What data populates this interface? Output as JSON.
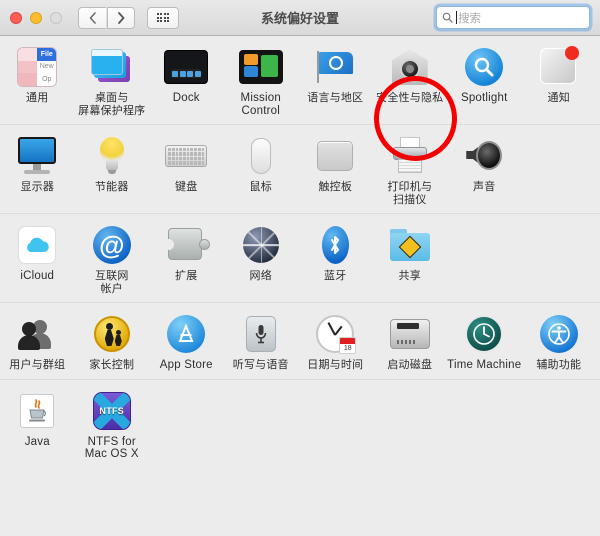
{
  "window": {
    "title": "系统偏好设置",
    "traffic_lights": [
      {
        "name": "close",
        "color": "#ff5f57",
        "enabled": true
      },
      {
        "name": "minimize",
        "color": "#ffbd2e",
        "enabled": true
      },
      {
        "name": "zoom",
        "color": "#dedede",
        "enabled": false
      }
    ]
  },
  "toolbar": {
    "back_label": "‹",
    "forward_label": "›",
    "show_all_label": "显示全部",
    "search": {
      "placeholder": "搜索",
      "value": "",
      "icon": "search-icon",
      "focused": true
    }
  },
  "annotation": {
    "type": "red-ellipse-highlight",
    "color": "#f40000",
    "targets": "安全性与隐私"
  },
  "rows": [
    {
      "index": 0,
      "items": [
        {
          "label": "通用",
          "icon": "general-icon"
        },
        {
          "label": "桌面与\n屏幕保护程序",
          "icon": "desktop-screensaver-icon"
        },
        {
          "label": "Dock",
          "icon": "dock-icon",
          "en": true
        },
        {
          "label": "Mission\nControl",
          "icon": "mission-control-icon",
          "en": true
        },
        {
          "label": "语言与地区",
          "icon": "language-region-icon"
        },
        {
          "label": "安全性与隐私",
          "icon": "security-privacy-icon",
          "highlighted": true
        },
        {
          "label": "Spotlight",
          "icon": "spotlight-icon",
          "en": true
        },
        {
          "label": "通知",
          "icon": "notifications-icon",
          "badge": true
        }
      ]
    },
    {
      "index": 1,
      "items": [
        {
          "label": "显示器",
          "icon": "displays-icon"
        },
        {
          "label": "节能器",
          "icon": "energy-saver-icon"
        },
        {
          "label": "键盘",
          "icon": "keyboard-icon"
        },
        {
          "label": "鼠标",
          "icon": "mouse-icon"
        },
        {
          "label": "触控板",
          "icon": "trackpad-icon"
        },
        {
          "label": "打印机与\n扫描仪",
          "icon": "printers-scanners-icon"
        },
        {
          "label": "声音",
          "icon": "sound-icon"
        }
      ]
    },
    {
      "index": 2,
      "items": [
        {
          "label": "iCloud",
          "icon": "icloud-icon",
          "en": true
        },
        {
          "label": "互联网\n帐户",
          "icon": "internet-accounts-icon"
        },
        {
          "label": "扩展",
          "icon": "extensions-icon"
        },
        {
          "label": "网络",
          "icon": "network-icon"
        },
        {
          "label": "蓝牙",
          "icon": "bluetooth-icon"
        },
        {
          "label": "共享",
          "icon": "sharing-icon"
        }
      ]
    },
    {
      "index": 3,
      "items": [
        {
          "label": "用户与群组",
          "icon": "users-groups-icon"
        },
        {
          "label": "家长控制",
          "icon": "parental-controls-icon"
        },
        {
          "label": "App Store",
          "icon": "app-store-icon",
          "en": true
        },
        {
          "label": "听写与语音",
          "icon": "dictation-speech-icon"
        },
        {
          "label": "日期与时间",
          "icon": "date-time-icon"
        },
        {
          "label": "启动磁盘",
          "icon": "startup-disk-icon"
        },
        {
          "label": "Time Machine",
          "icon": "time-machine-icon",
          "en": true
        },
        {
          "label": "辅助功能",
          "icon": "accessibility-icon"
        }
      ]
    },
    {
      "index": 4,
      "items": [
        {
          "label": "Java",
          "icon": "java-icon",
          "en": true
        },
        {
          "label": "NTFS for\nMac OS X",
          "icon": "ntfs-icon",
          "en": true
        }
      ]
    }
  ],
  "icon_glyphs": {
    "general_tiles": [
      "",
      "File",
      "",
      "New",
      "",
      "Op"
    ],
    "ntfs_tag": "NTFS",
    "date_badge_number": "18"
  },
  "colors": {
    "window_bg": "#ececec",
    "titlebar_top": "#e9e9e9",
    "titlebar_bottom": "#d9d9d9",
    "separator": "#dcdcdc",
    "label_text": "#2e2e2e",
    "title_text": "#4b4b4b",
    "annotation_red": "#f40000",
    "badge_red": "#f22b1f",
    "search_focus_ring": "#6eaae6"
  }
}
